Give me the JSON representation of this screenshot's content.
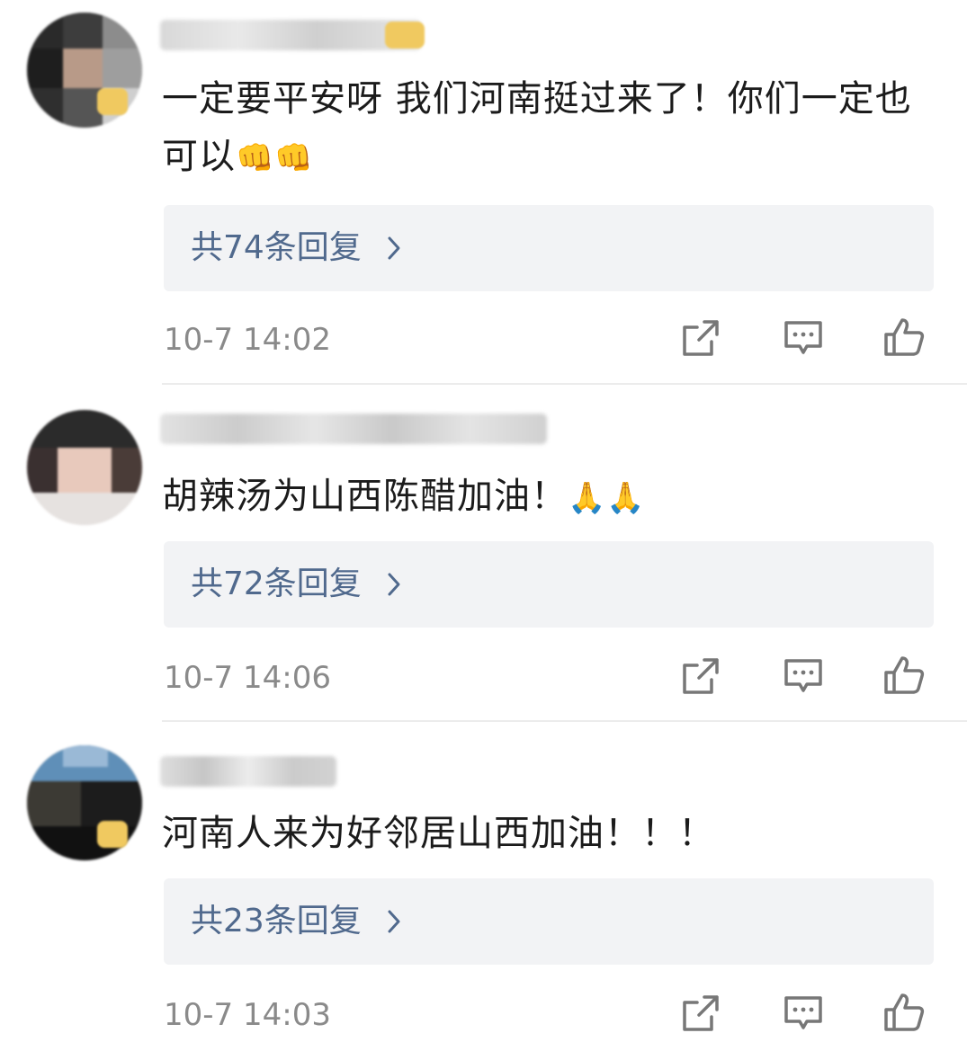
{
  "colors": {
    "reply_link": "#50698d",
    "reply_bg": "#f2f3f5",
    "timestamp": "#8a8a8a",
    "text": "#1b1b1b"
  },
  "comments": [
    {
      "text": "一定要平安呀 我们河南挺过来了！你们一定也可以",
      "emoji": "👊👊",
      "replies_label": "共74条回复",
      "timestamp": "10-7 14:02",
      "avatar_blurred": true,
      "username_blurred": true
    },
    {
      "text": "胡辣汤为山西陈醋加油！",
      "emoji": "🙏🙏",
      "replies_label": "共72条回复",
      "timestamp": "10-7 14:06",
      "avatar_blurred": true,
      "username_blurred": true
    },
    {
      "text": "河南人来为好邻居山西加油！！！",
      "emoji": "",
      "replies_label": "共23条回复",
      "timestamp": "10-7 14:03",
      "avatar_blurred": true,
      "username_blurred": true
    }
  ],
  "icons": {
    "share": "share-icon",
    "comment": "comment-icon",
    "like": "thumbs-up-icon",
    "chevron": "chevron-right-icon"
  }
}
